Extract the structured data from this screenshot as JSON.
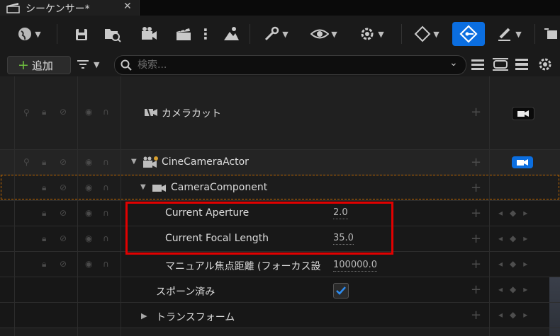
{
  "tab": {
    "title": "シーケンサー*",
    "close": "✕"
  },
  "toolbar": {
    "items": [
      "world-icon",
      "save-icon",
      "browse-icon",
      "camera-add-icon",
      "clapper-icon",
      "more-icon",
      "render-icon",
      "wrench-icon",
      "visibility-icon",
      "settings-gear-icon",
      "keyframe-icon",
      "auto-key-icon",
      "brush-icon",
      "export-icon"
    ]
  },
  "searchbar": {
    "add_label": "追加",
    "search_placeholder": "検索..."
  },
  "tracks": [
    {
      "name": "camera-cut-track",
      "label": "カメラカット"
    },
    {
      "name": "cine-camera-actor-track",
      "label": "CineCameraActor"
    },
    {
      "name": "camera-component-track",
      "label": "CameraComponent"
    },
    {
      "name": "current-aperture-track",
      "label": "Current Aperture",
      "value": "2.0"
    },
    {
      "name": "current-focal-length-track",
      "label": "Current Focal Length",
      "value": "35.0"
    },
    {
      "name": "manual-focus-distance-track",
      "label": "マニュアル焦点距離 (フォーカス設",
      "value": "100000.0"
    },
    {
      "name": "spawned-track",
      "label": "スポーン済み",
      "checked": true
    },
    {
      "name": "transform-track",
      "label": "トランスフォーム"
    }
  ],
  "colors": {
    "accent_blue": "#0b6ee0",
    "highlight_red": "#e10000",
    "add_green": "#6fbf3f",
    "selection_orange": "#c46a00"
  }
}
